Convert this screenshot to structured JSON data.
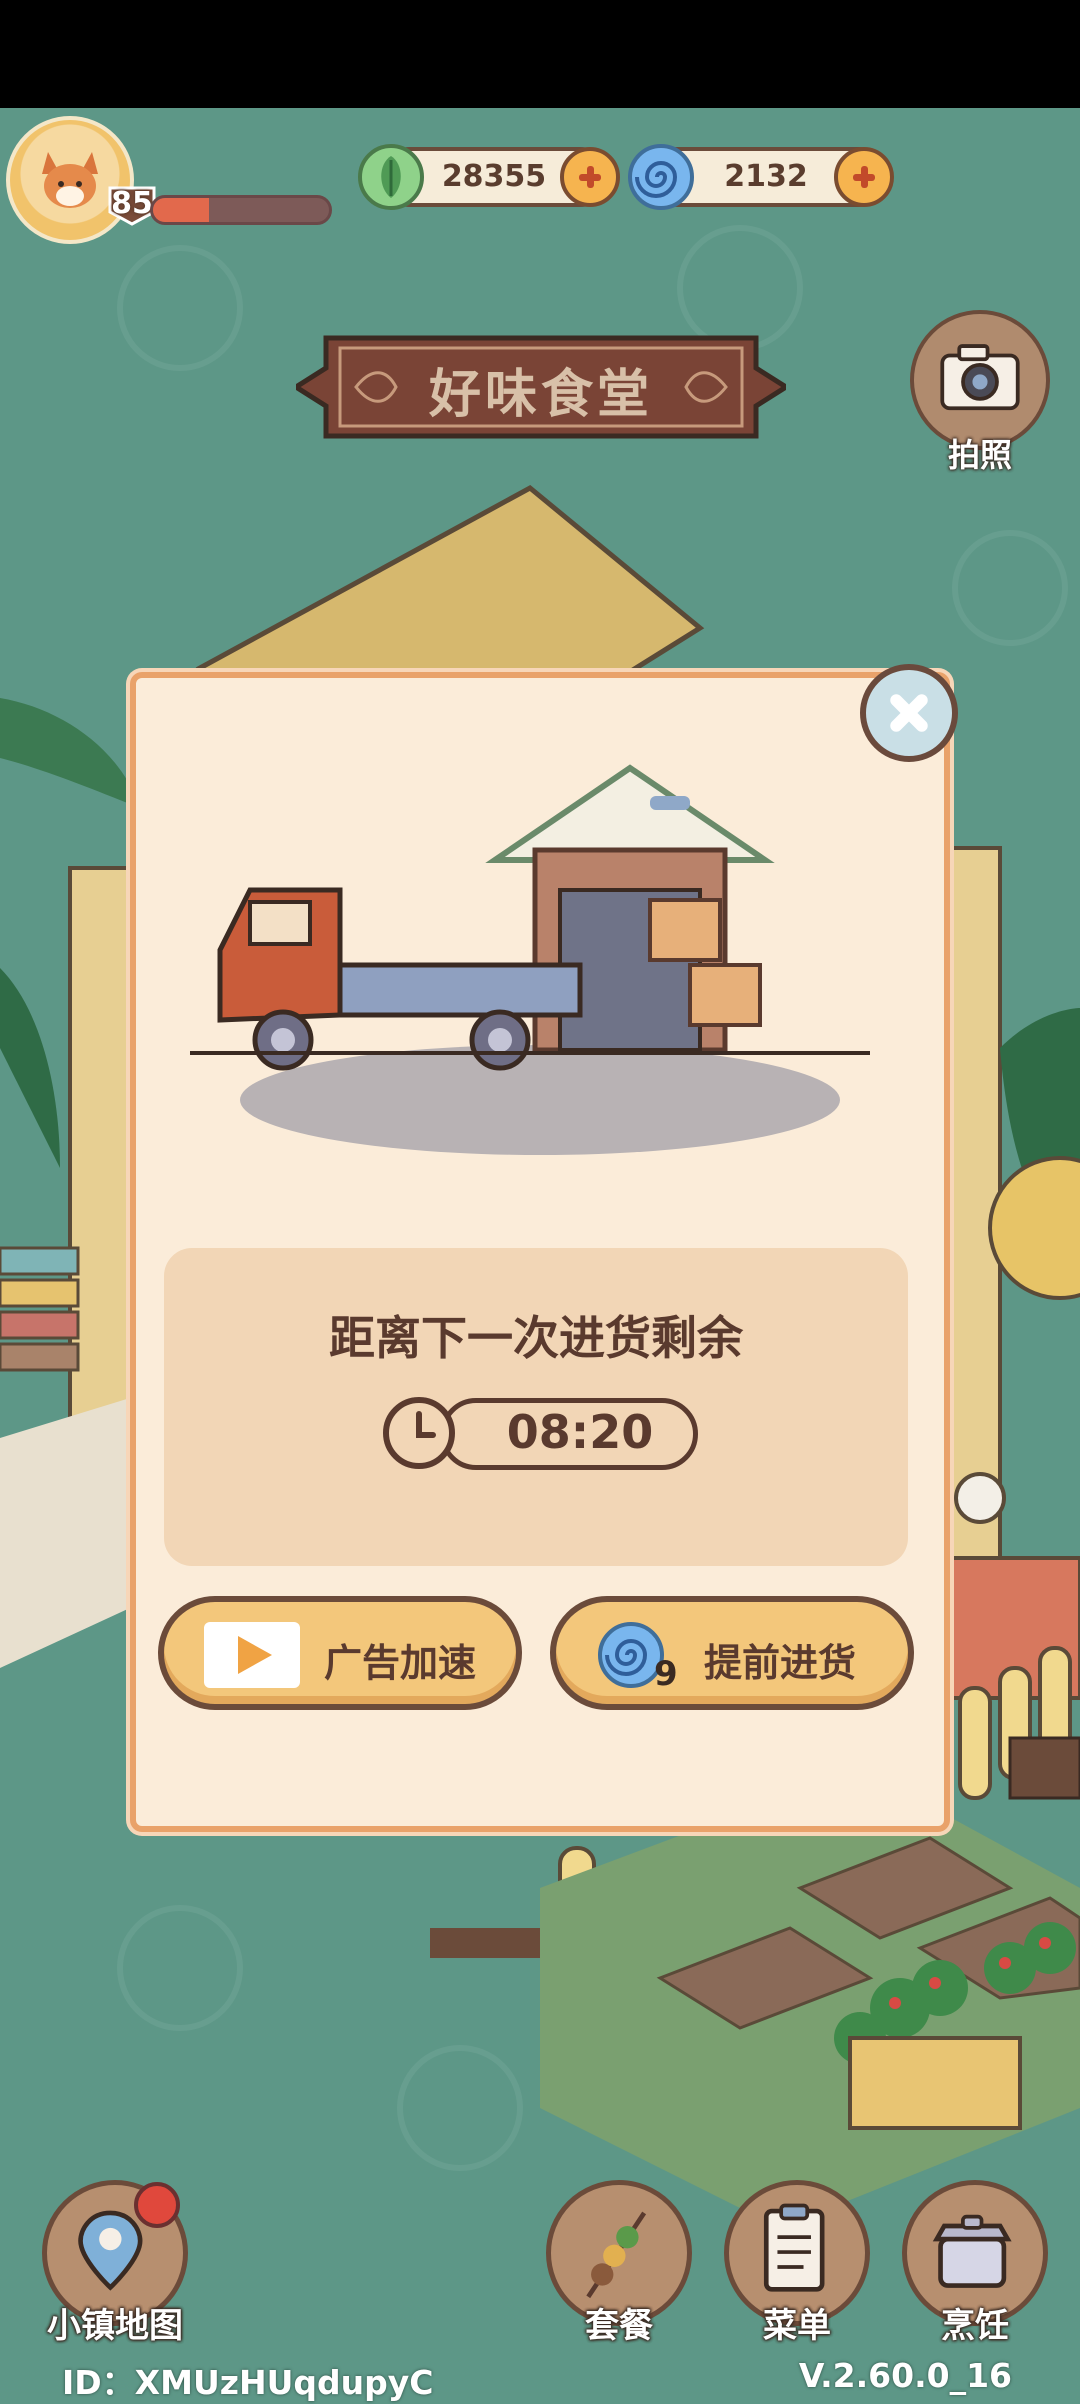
{
  "player": {
    "level": "85",
    "xp_fraction": 0.32
  },
  "currencies": [
    {
      "name": "leaf-coin",
      "value": "28355"
    },
    {
      "name": "swirl-gem",
      "value": "2132"
    }
  ],
  "sign": {
    "title": "好味食堂"
  },
  "camera": {
    "label": "拍照"
  },
  "restock_dialog": {
    "countdown_title": "距离下一次进货剩余",
    "countdown_time": "08:20",
    "ad_button_label": "广告加速",
    "restock_button_label": "提前进货",
    "restock_cost": "9"
  },
  "bottom_nav": {
    "map": "小镇地图",
    "combo": "套餐",
    "menu": "菜单",
    "cook": "烹饪"
  },
  "footer": {
    "id": "ID：XMUzHUqdupyC",
    "version": "V.2.60.0_16"
  },
  "colors": {
    "background": "#5d9787",
    "panel": "#fbecd9",
    "button": "#f3c77b",
    "accent": "#e9a26a"
  }
}
